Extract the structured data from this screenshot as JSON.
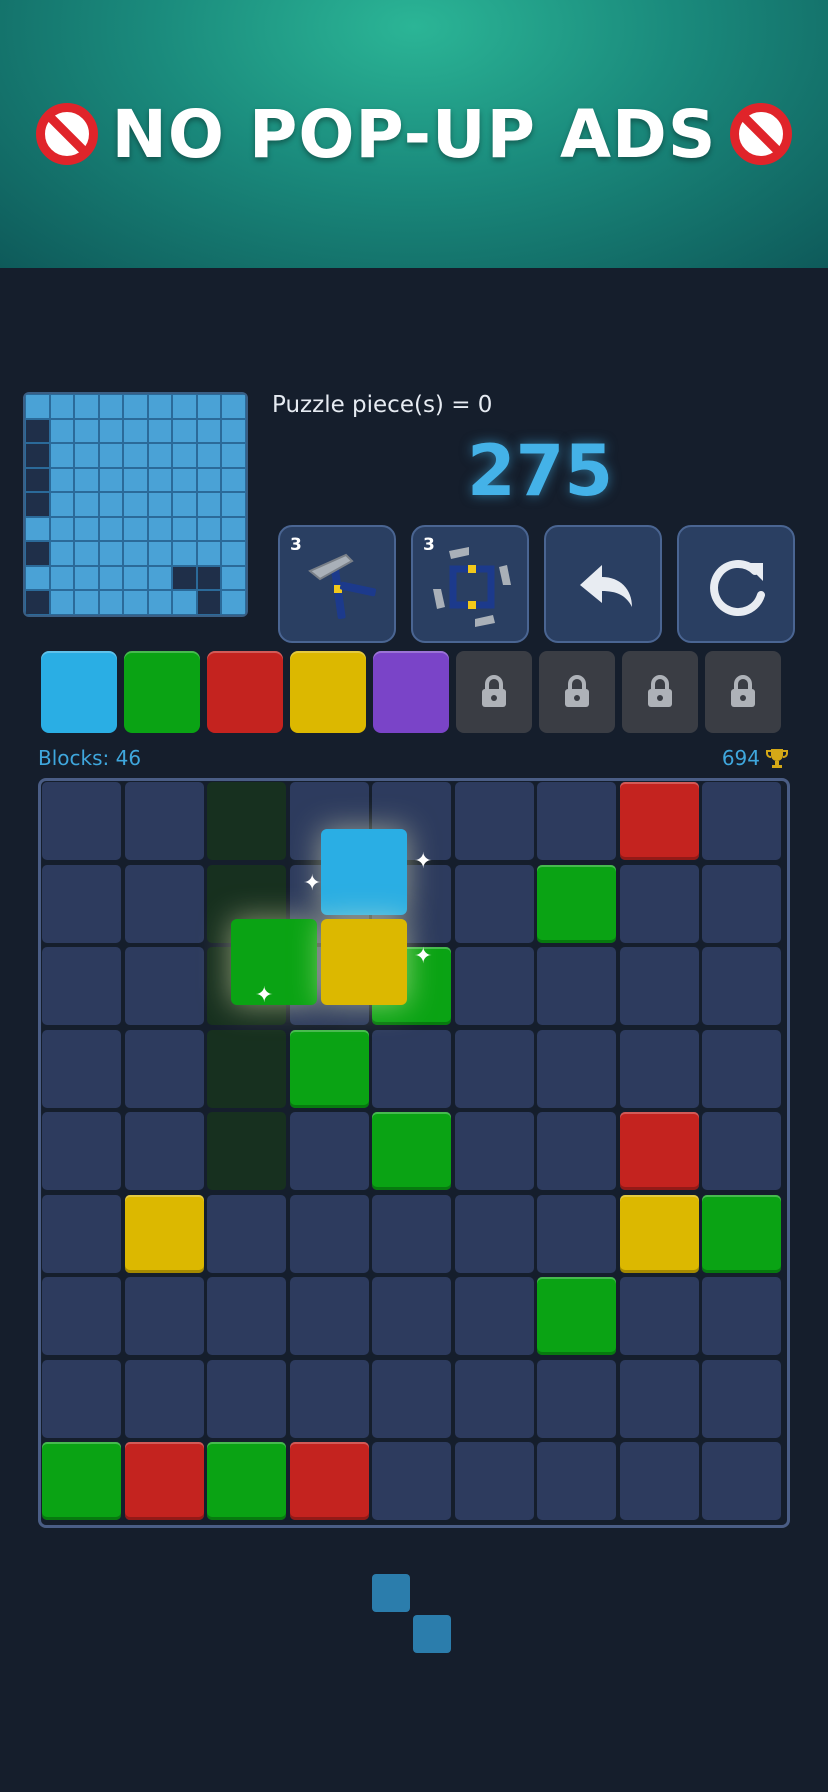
{
  "banner": {
    "text": "NO POP-UP ADS",
    "icon": "no-entry-icon"
  },
  "minimap": {
    "rows": [
      [
        1,
        1,
        1,
        1,
        1,
        1,
        1,
        1,
        1
      ],
      [
        0,
        1,
        1,
        1,
        1,
        1,
        1,
        1,
        1
      ],
      [
        0,
        1,
        1,
        1,
        1,
        1,
        1,
        1,
        1
      ],
      [
        0,
        1,
        1,
        1,
        1,
        1,
        1,
        1,
        1
      ],
      [
        0,
        1,
        1,
        1,
        1,
        1,
        1,
        1,
        1
      ],
      [
        1,
        1,
        1,
        1,
        1,
        1,
        1,
        1,
        1
      ],
      [
        0,
        1,
        1,
        1,
        1,
        1,
        1,
        1,
        1
      ],
      [
        1,
        1,
        1,
        1,
        1,
        1,
        0,
        0,
        1
      ],
      [
        0,
        1,
        1,
        1,
        1,
        1,
        1,
        0,
        1
      ]
    ]
  },
  "puzzle_pieces_label": "Puzzle piece(s) = 0",
  "score": "275",
  "tools": [
    {
      "name": "hammer-tool",
      "count": "3"
    },
    {
      "name": "hammers-tool",
      "count": "3"
    },
    {
      "name": "undo-tool",
      "count": ""
    },
    {
      "name": "restart-tool",
      "count": ""
    }
  ],
  "colors": {
    "palette": [
      "#2aaee4",
      "#0aa314",
      "#c4231f",
      "#dcb800",
      "#7a44c8"
    ],
    "locked_count": 4
  },
  "blocks_label": "Blocks: 46",
  "best_score": "694",
  "board": {
    "size": 9,
    "dark_cells": [
      [
        2,
        0
      ],
      [
        2,
        1
      ],
      [
        2,
        2
      ],
      [
        2,
        3
      ],
      [
        2,
        4
      ]
    ],
    "tiles": [
      {
        "c": 7,
        "r": 0,
        "color": "red"
      },
      {
        "c": 6,
        "r": 1,
        "color": "green"
      },
      {
        "c": 4,
        "r": 2,
        "color": "green"
      },
      {
        "c": 3,
        "r": 3,
        "color": "green"
      },
      {
        "c": 4,
        "r": 4,
        "color": "green"
      },
      {
        "c": 7,
        "r": 4,
        "color": "red"
      },
      {
        "c": 1,
        "r": 5,
        "color": "yellow"
      },
      {
        "c": 7,
        "r": 5,
        "color": "yellow"
      },
      {
        "c": 8,
        "r": 5,
        "color": "green"
      },
      {
        "c": 6,
        "r": 6,
        "color": "green"
      },
      {
        "c": 0,
        "r": 8,
        "color": "green"
      },
      {
        "c": 1,
        "r": 8,
        "color": "red"
      },
      {
        "c": 2,
        "r": 8,
        "color": "green"
      },
      {
        "c": 3,
        "r": 8,
        "color": "red"
      }
    ],
    "tile_colors": {
      "red": "#c4231f",
      "green": "#0aa314",
      "yellow": "#dcb800",
      "blue": "#2aaee4"
    }
  },
  "dragging_piece": [
    "blue",
    "green",
    "yellow"
  ],
  "next_piece": [
    "blue",
    "blue"
  ]
}
